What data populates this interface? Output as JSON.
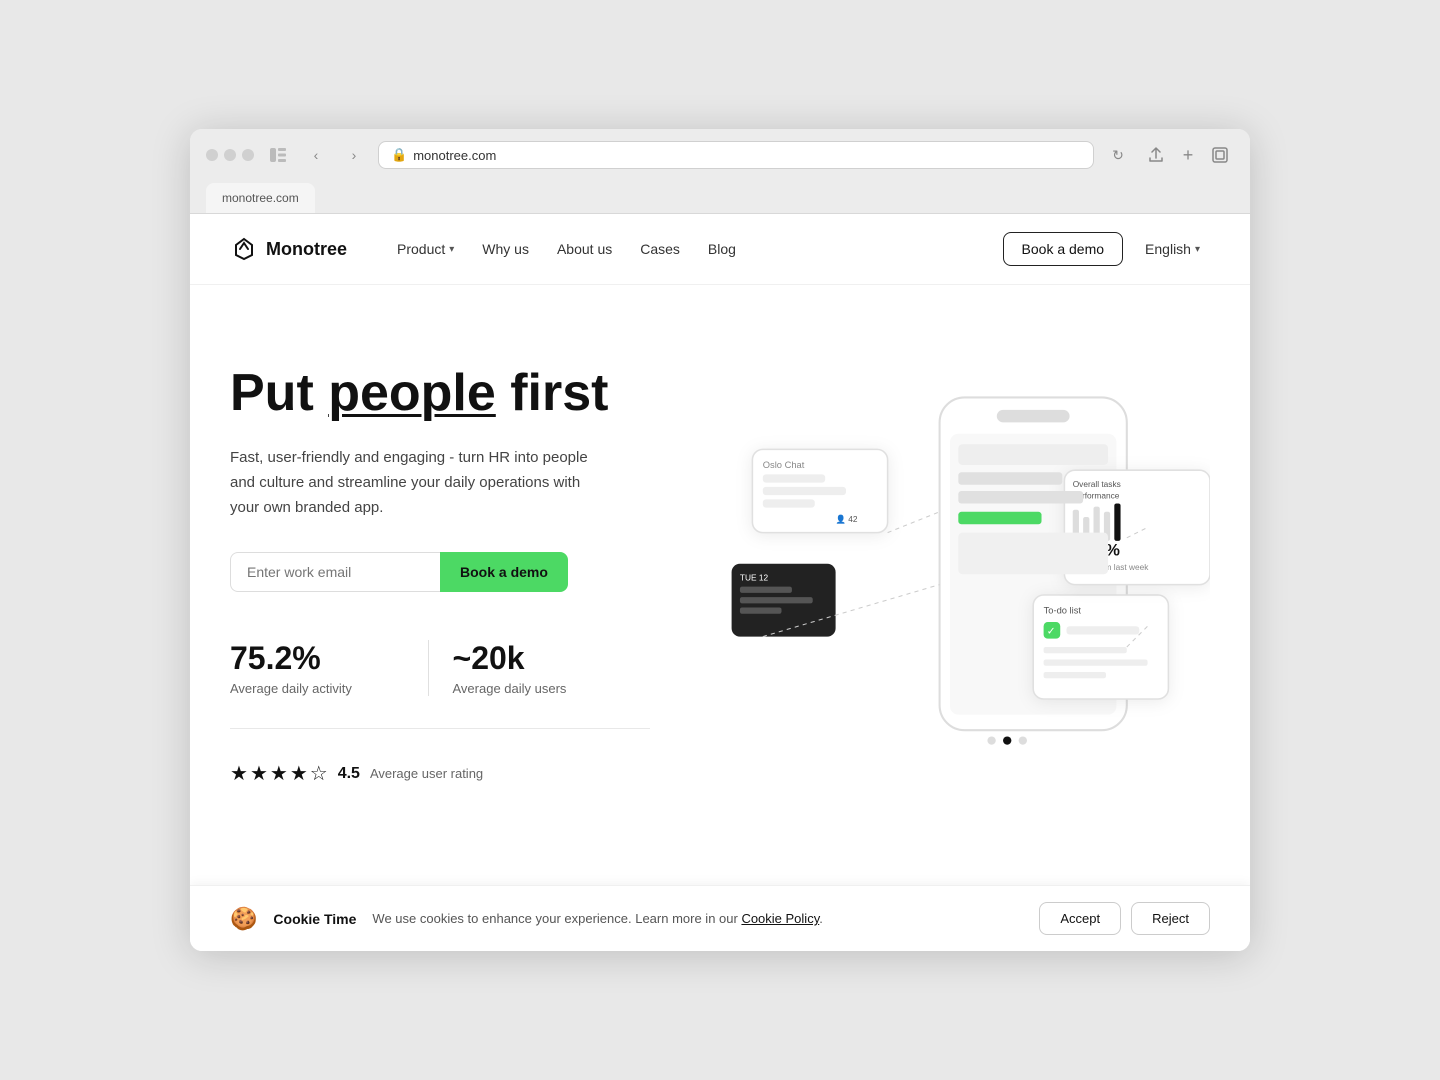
{
  "browser": {
    "address": "monotree.com",
    "tab_label": "monotree.com"
  },
  "navbar": {
    "logo_text": "Monotree",
    "nav_items": [
      {
        "label": "Product",
        "has_dropdown": true
      },
      {
        "label": "Why us",
        "has_dropdown": false
      },
      {
        "label": "About us",
        "has_dropdown": false
      },
      {
        "label": "Cases",
        "has_dropdown": false
      },
      {
        "label": "Blog",
        "has_dropdown": false
      }
    ],
    "cta_label": "Book a demo",
    "lang_label": "English"
  },
  "hero": {
    "title_part1": "Put ",
    "title_highlight": "people",
    "title_part2": " first",
    "description": "Fast, user-friendly and engaging - turn HR into people and culture and streamline your daily operations with your own branded app.",
    "email_placeholder": "Enter work email",
    "cta_label": "Book a demo"
  },
  "stats": [
    {
      "value": "75.2%",
      "label": "Average daily activity"
    },
    {
      "value": "~20k",
      "label": "Average daily users"
    }
  ],
  "rating": {
    "value": "4.5",
    "label": "Average user rating",
    "stars": 4.5
  },
  "illustration": {
    "phone_label": "Oslo Chat",
    "chat_count": "42",
    "todo_label": "To-do list",
    "perf_label": "Overall tasks performance",
    "perf_value": "85.3%"
  },
  "cookie": {
    "icon": "🍪",
    "brand": "Cookie Time",
    "text": "We use cookies to enhance your experience. Learn more in our ",
    "link_text": "Cookie Policy",
    "text_end": ".",
    "accept_label": "Accept",
    "reject_label": "Reject"
  }
}
